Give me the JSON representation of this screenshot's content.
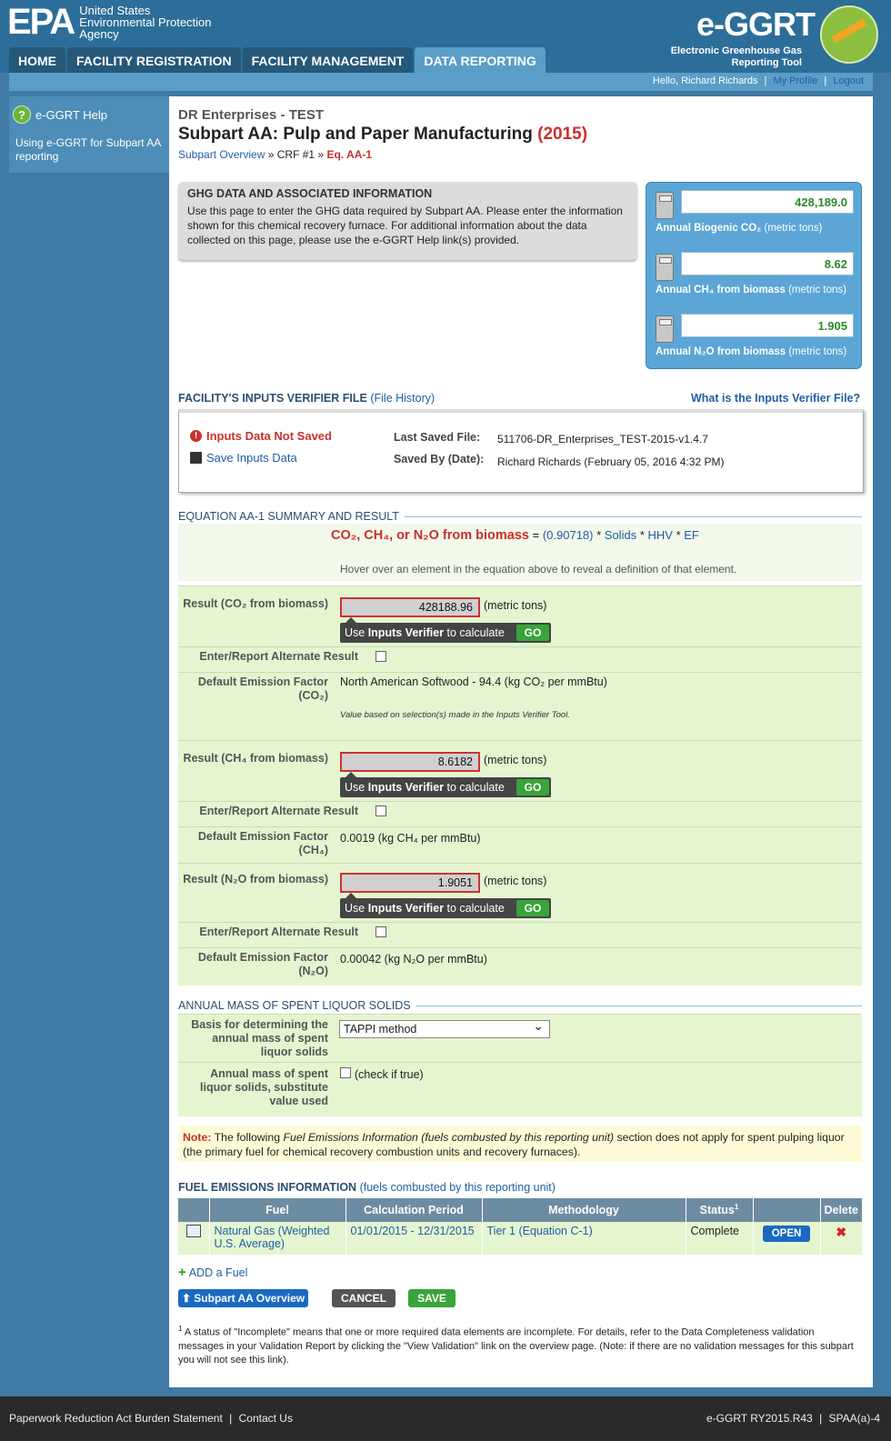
{
  "header": {
    "epa_mark": "EPA",
    "agency_name": "United States Environmental Protection Agency",
    "tool_title": "e-GGRT",
    "tool_subtitle": "Electronic Greenhouse Gas Reporting Tool"
  },
  "nav": {
    "tabs": [
      {
        "label": "HOME"
      },
      {
        "label": "FACILITY REGISTRATION"
      },
      {
        "label": "FACILITY MANAGEMENT"
      },
      {
        "label": "DATA REPORTING"
      }
    ],
    "active_tab": "DATA REPORTING"
  },
  "user_bar": {
    "greeting": "Hello, Richard Richards",
    "profile": "My Profile",
    "logout": "Logout"
  },
  "sidebar": {
    "help_title": "e-GGRT Help",
    "help_link": "Using e-GGRT for Subpart AA reporting"
  },
  "page": {
    "company": "DR Enterprises - TEST",
    "title": "Subpart AA: Pulp and Paper Manufacturing",
    "year": "(2015)",
    "breadcrumb": {
      "overview": "Subpart Overview",
      "sep1": "»",
      "crf": "CRF #1",
      "sep2": "»",
      "current": "Eq. AA-1"
    }
  },
  "ghg_box": {
    "heading": "GHG DATA AND ASSOCIATED INFORMATION",
    "text": "Use this page to enter the GHG data required by Subpart AA. Please enter the information shown for this chemical recovery furnace. For additional information about the data collected on this page, please use the e-GGRT Help link(s) provided."
  },
  "totals": [
    {
      "value": "428,189.0",
      "label_bold": "Annual Biogenic CO₂",
      "label_rest": "(metric tons)"
    },
    {
      "value": "8.62",
      "label_bold": "Annual CH₄ from biomass",
      "label_rest": "(metric tons)"
    },
    {
      "value": "1.905",
      "label_bold": "Annual N₂O from biomass",
      "label_rest": "(metric tons)"
    }
  ],
  "verifier": {
    "title": "FACILITY'S INPUTS VERIFIER FILE",
    "history_link": "(File History)",
    "what_link": "What is the Inputs Verifier File?",
    "not_saved": "Inputs Data Not Saved",
    "save_link": "Save Inputs Data",
    "last_saved_label": "Last Saved File:",
    "last_saved_value": "511706-DR_Enterprises_TEST-2015-v1.4.7",
    "saved_by_label": "Saved By (Date):",
    "saved_by_value": "Richard Richards (February 05, 2016 4:32 PM)"
  },
  "equation": {
    "section_title": "EQUATION AA-1 SUMMARY AND RESULT",
    "lhs": "CO₂, CH₄, or N₂O from biomass",
    "equals": " = ",
    "factor": "(0.90718)",
    "op1": " * ",
    "solids": "Solids",
    "op2": " * ",
    "hhv": "HHV",
    "op3": " * ",
    "ef": "EF",
    "hover_hint": "Hover over an element in the equation above to reveal a definition of that element."
  },
  "results": {
    "co2": {
      "label": "Result (CO₂ from biomass)",
      "value": "428188.96",
      "unit": "(metric tons)",
      "verify_pre": "Use ",
      "verify_bold": "Inputs Verifier",
      "verify_post": " to calculate",
      "go": "GO",
      "alt_label": "Enter/Report Alternate Result",
      "ef_label": "Default Emission Factor (CO₂)",
      "ef_value": "North American Softwood - 94.4",
      "ef_unit": "(kg CO₂ per mmBtu)",
      "ef_note": "Value based on selection(s) made in the Inputs Verifier Tool."
    },
    "ch4": {
      "label": "Result (CH₄ from biomass)",
      "value": "8.6182",
      "unit": "(metric tons)",
      "verify_pre": "Use ",
      "verify_bold": "Inputs Verifier",
      "verify_post": " to calculate",
      "go": "GO",
      "alt_label": "Enter/Report Alternate Result",
      "ef_label": "Default Emission Factor (CH₄)",
      "ef_value": "0.0019",
      "ef_unit": "(kg CH₄ per mmBtu)"
    },
    "n2o": {
      "label": "Result (N₂O from biomass)",
      "value": "1.9051",
      "unit": "(metric tons)",
      "verify_pre": "Use ",
      "verify_bold": "Inputs Verifier",
      "verify_post": " to calculate",
      "go": "GO",
      "alt_label": "Enter/Report Alternate Result",
      "ef_label": "Default Emission Factor (N₂O)",
      "ef_value": "0.00042",
      "ef_unit": "(kg N₂O per mmBtu)"
    }
  },
  "mass": {
    "section_title": "ANNUAL MASS OF SPENT LIQUOR SOLIDS",
    "basis_label": "Basis for determining the annual mass of spent liquor solids",
    "basis_value": "TAPPI method",
    "subst_label": "Annual mass of spent liquor solids, substitute value used",
    "subst_check_label": "(check if true)"
  },
  "note": {
    "label": "Note:",
    "pre": " The following ",
    "italic": "Fuel Emissions Information (fuels combusted by this reporting unit)",
    "post": " section does not apply for spent pulping liquor (the primary fuel for chemical recovery combustion units and recovery furnaces)."
  },
  "fuel": {
    "section_title": "FUEL EMISSIONS INFORMATION",
    "section_sub": "(fuels combusted by this reporting unit)",
    "headers": [
      "",
      "Fuel",
      "Calculation Period",
      "Methodology",
      "Status",
      "",
      "Delete"
    ],
    "status_sup": "1",
    "rows": [
      {
        "fuel": "Natural Gas (Weighted U.S. Average)",
        "period": "01/01/2015 - 12/31/2015",
        "method": "Tier 1 (Equation C-1)",
        "status": "Complete",
        "open": "OPEN",
        "delete": "✖"
      }
    ],
    "add": "ADD a Fuel"
  },
  "buttons": {
    "overview": "Subpart AA Overview",
    "cancel": "CANCEL",
    "save": "SAVE"
  },
  "footnote": {
    "sup": "1",
    "text": " A status of \"Incomplete\" means that one or more required data elements are incomplete. For details, refer to the Data Completeness validation messages in your Validation Report by clicking the \"View Validation\" link on the overview page. (Note: if there are no validation messages for this subpart you will not see this link)."
  },
  "footer": {
    "paperwork": "Paperwork Reduction Act Burden Statement",
    "contact": "Contact Us",
    "version": "e-GGRT RY2015.R43",
    "page_id": "SPAA(a)-4"
  }
}
